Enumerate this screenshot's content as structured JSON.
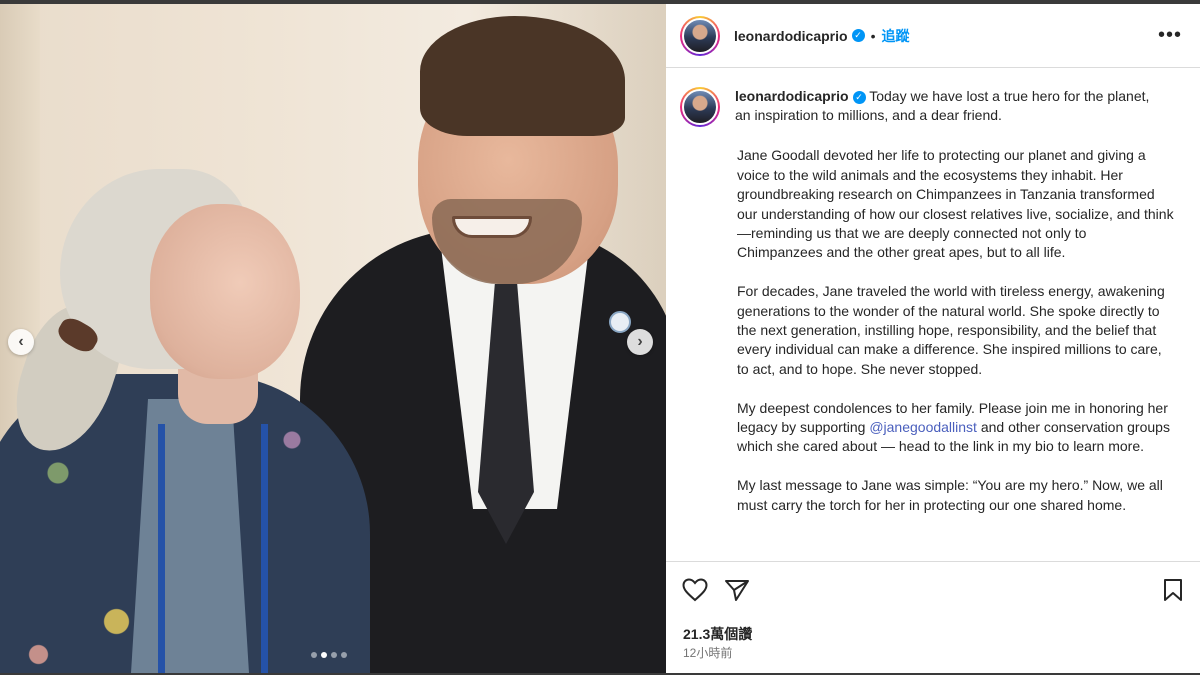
{
  "post": {
    "username": "leonardodicaprio",
    "verified_mark": "✓",
    "separator": "•",
    "follow_label": "追蹤",
    "more_label": "•••",
    "caption_first": "Today we have lost a true hero for the planet, an inspiration to millions, and a dear friend.",
    "paragraphs": {
      "p1": "Jane Goodall devoted her life to protecting our planet and giving a voice to the wild animals and the ecosystems they inhabit. Her groundbreaking research on Chimpanzees in Tanzania transformed our understanding of how our closest relatives live, socialize, and think—reminding us that we are deeply connected not only to Chimpanzees and the other great apes, but to all life.",
      "p2": "For decades, Jane traveled the world with tireless energy, awakening generations to the wonder of the natural world. She spoke directly to the next generation, instilling hope, responsibility, and the belief that every individual can make a difference. She inspired millions to care, to act, and to hope. She never stopped.",
      "p3_before": "My deepest condolences to her family. Please join me in honoring her legacy by supporting ",
      "p3_mention": "@janegoodallinst",
      "p3_after": " and other conservation groups which she cared about — head to the link in my bio to learn more.",
      "p4": "My last message to Jane was simple: “You are my hero.” Now, we all must carry the torch for her in protecting our one shared home."
    },
    "likes": "21.3萬個讚",
    "time_ago": "12小時前"
  },
  "carousel": {
    "prev_label": "‹",
    "next_label": "›",
    "slide_count": 4,
    "active_index": 1
  },
  "icons": {
    "like": "heart-icon",
    "share": "paper-plane-icon",
    "save": "bookmark-icon",
    "more": "more-options-icon"
  },
  "colors": {
    "accent": "#0095f6",
    "mention": "#4a5fbd",
    "text": "#262626",
    "muted": "#737373"
  }
}
